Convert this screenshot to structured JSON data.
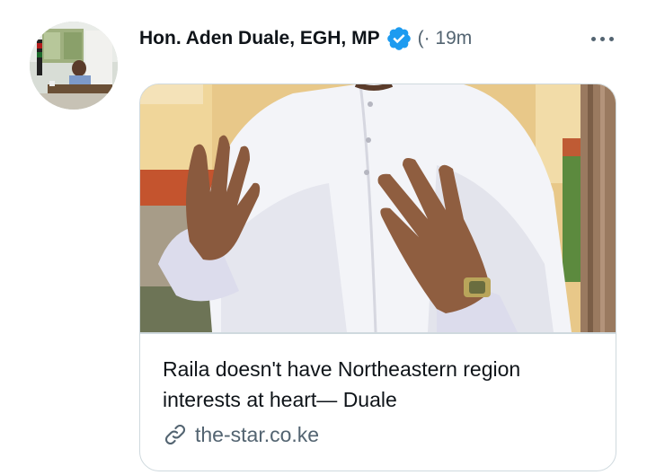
{
  "tweet": {
    "author_name": "Hon. Aden Duale, EGH, MP",
    "handle_truncated": "(",
    "time": "· 19m",
    "avatar_icon": "avatar-photo",
    "verified_icon": "verified-badge-icon",
    "more_icon": "more-options-icon"
  },
  "card": {
    "title": "Raila doesn't have Northeastern region interests at heart— Duale",
    "domain": "the-star.co.ke",
    "link_icon": "link-icon"
  },
  "colors": {
    "verified_blue": "#1d9bf0",
    "secondary_text": "#536471",
    "border": "#cfd9de"
  }
}
